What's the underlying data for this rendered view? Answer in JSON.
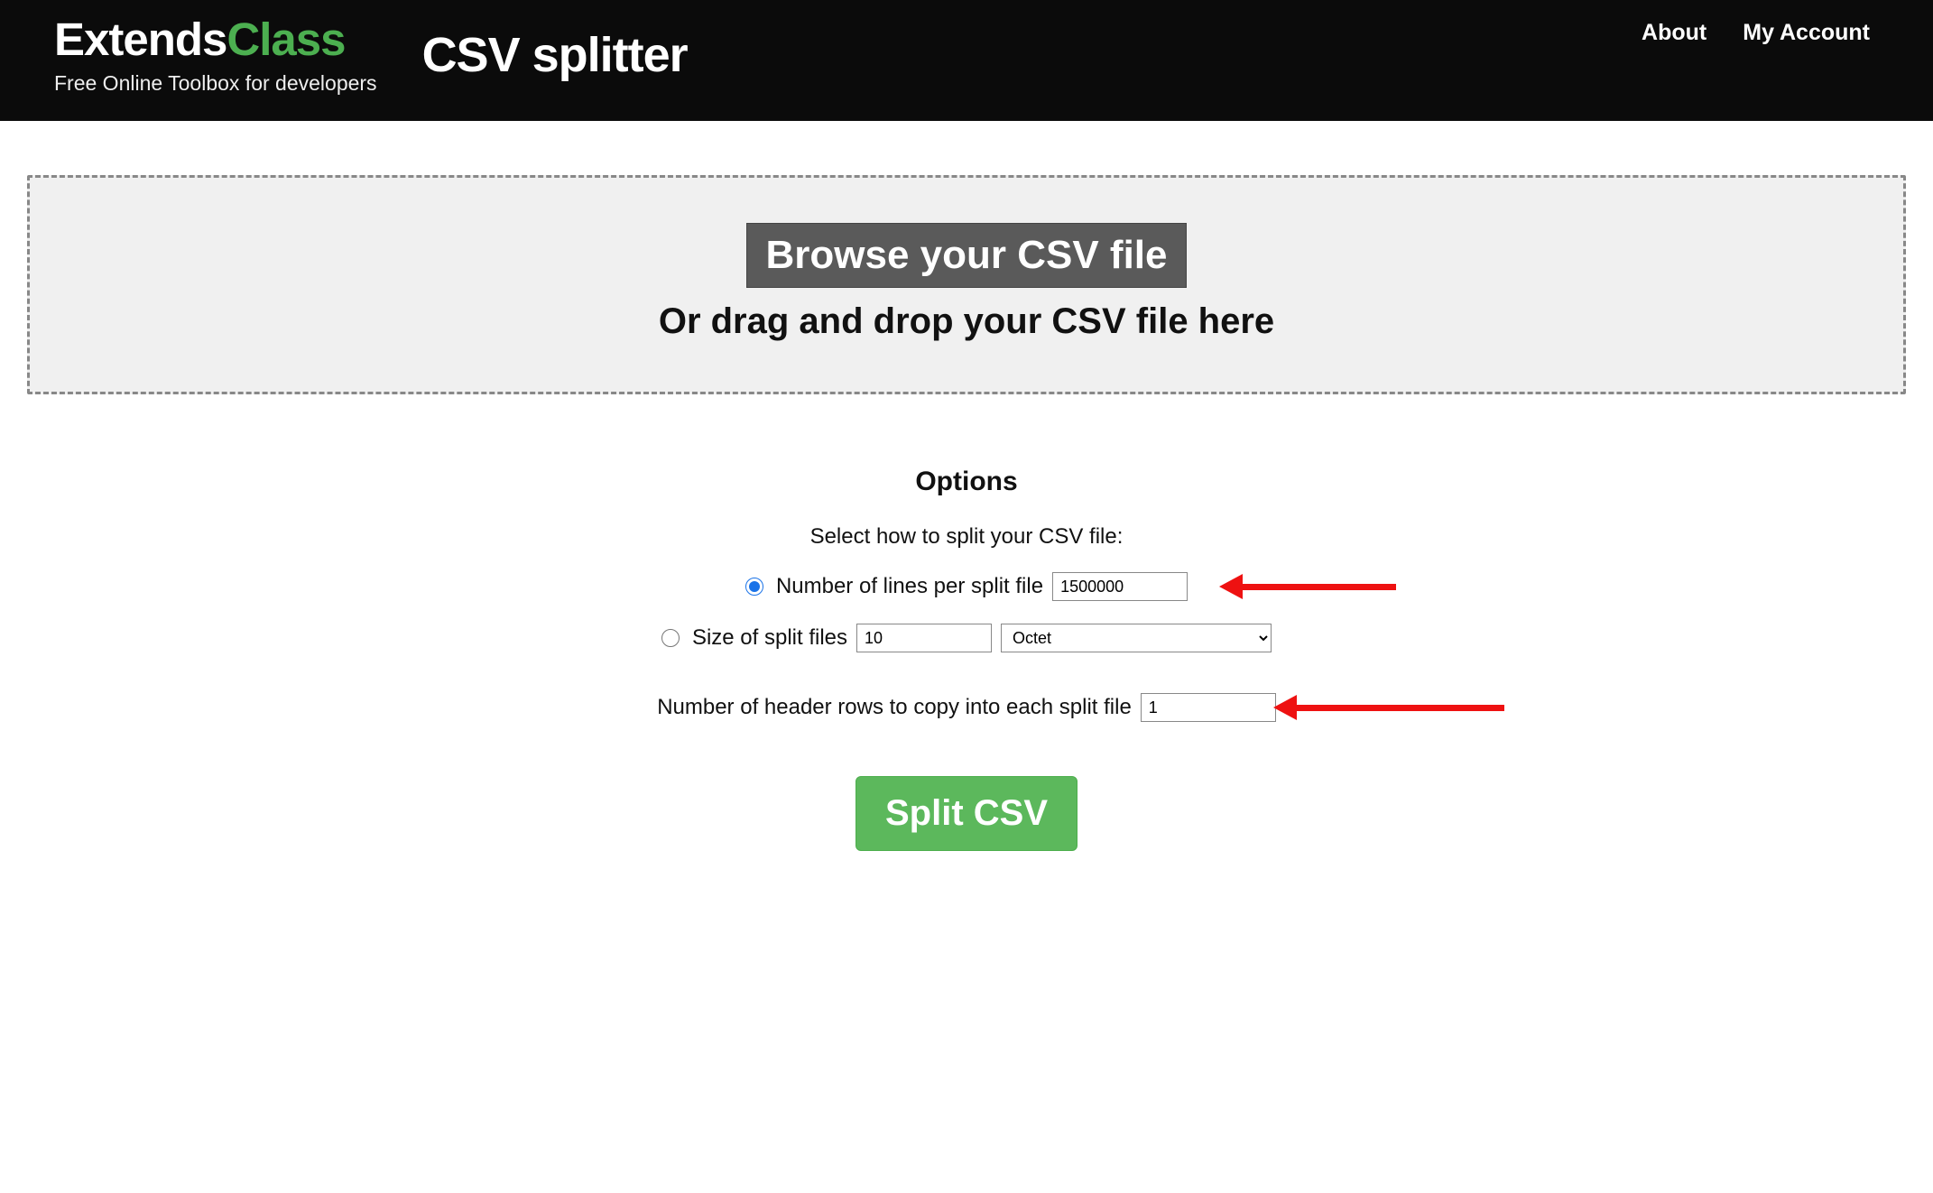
{
  "brand": {
    "name1": "Extends",
    "name2": "Class",
    "tagline": "Free Online Toolbox for developers"
  },
  "page_title": "CSV splitter",
  "nav": {
    "about": "About",
    "account": "My Account"
  },
  "dropzone": {
    "browse": "Browse your CSV file",
    "drag": "Or drag and drop your CSV file here"
  },
  "options": {
    "title": "Options",
    "subtitle": "Select how to split your CSV file:",
    "by_lines_label": "Number of lines per split file",
    "by_lines_value": "1500000",
    "by_size_label": "Size of split files",
    "by_size_value": "10",
    "by_size_unit": "Octet",
    "header_label": "Number of header rows to copy into each split file",
    "header_value": "1",
    "selected": "lines"
  },
  "action": {
    "split": "Split CSV"
  }
}
